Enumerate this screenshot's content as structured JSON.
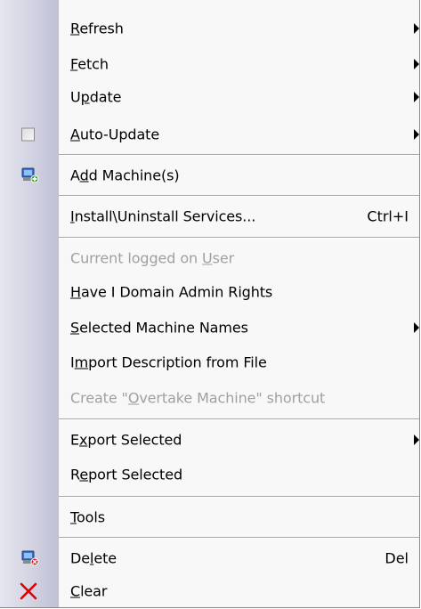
{
  "menu": {
    "refresh": {
      "before": "",
      "key": "R",
      "after": "efresh"
    },
    "fetch": {
      "before": "",
      "key": "F",
      "after": "etch"
    },
    "update": {
      "before": "U",
      "key": "p",
      "after": "date"
    },
    "auto_update": {
      "before": "",
      "key": "A",
      "after": "uto-Update"
    },
    "add_machine": {
      "before": "A",
      "key": "d",
      "after": "d Machine(s)"
    },
    "install_services": {
      "before": "",
      "key": "I",
      "after": "nstall\\Uninstall Services...",
      "shortcut": "Ctrl+I"
    },
    "current_user": {
      "before": "Current logged on ",
      "key": "U",
      "after": "ser"
    },
    "domain_admin": {
      "before": "",
      "key": "H",
      "after": "ave I Domain Admin Rights"
    },
    "selected_names": {
      "before": "",
      "key": "S",
      "after": "elected Machine Names"
    },
    "import_description": {
      "before": "I",
      "key": "m",
      "after": "port Description from File"
    },
    "overtake_shortcut": {
      "before": "Create \"",
      "key": "O",
      "after": "vertake Machine\" shortcut"
    },
    "export_selected": {
      "before": "E",
      "key": "x",
      "after": "port Selected"
    },
    "report_selected": {
      "before": "R",
      "key": "e",
      "after": "port Selected"
    },
    "tools": {
      "before": "",
      "key": "T",
      "after": "ools"
    },
    "delete": {
      "before": "De",
      "key": "l",
      "after": "ete",
      "shortcut": "Del"
    },
    "clear": {
      "before": "",
      "key": "C",
      "after": "lear"
    }
  },
  "icons": {
    "checkbox": "checkbox-icon",
    "add_machine": "computer-add-icon",
    "delete": "computer-delete-icon",
    "clear": "red-x-icon"
  },
  "colors": {
    "disabled_text": "#a0a0a0",
    "gutter": "#d2d2e2",
    "clear_icon": "#e00000"
  }
}
